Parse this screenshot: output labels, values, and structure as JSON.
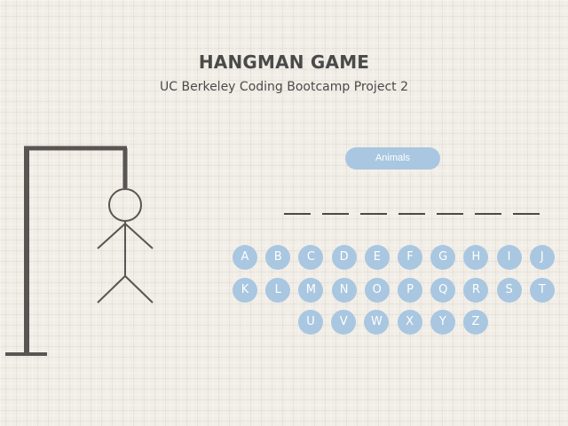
{
  "header": {
    "title": "HANGMAN GAME",
    "subtitle": "UC Berkeley Coding Bootcamp Project 2"
  },
  "game": {
    "category": "Animals",
    "word_length": 7,
    "figure_parts_visible": [
      "head",
      "body",
      "left-arm",
      "right-arm",
      "left-leg",
      "right-leg"
    ]
  },
  "keyboard": {
    "rows": [
      [
        "A",
        "B",
        "C",
        "D",
        "E",
        "F",
        "G",
        "H",
        "I",
        "J"
      ],
      [
        "K",
        "L",
        "M",
        "N",
        "O",
        "P",
        "Q",
        "R",
        "S",
        "T"
      ],
      [
        "U",
        "V",
        "W",
        "X",
        "Y",
        "Z"
      ]
    ]
  },
  "colors": {
    "button": "#a9c7e0",
    "text": "#4a4a4a",
    "gallows": "#5a5553",
    "background": "#f1ede7"
  }
}
